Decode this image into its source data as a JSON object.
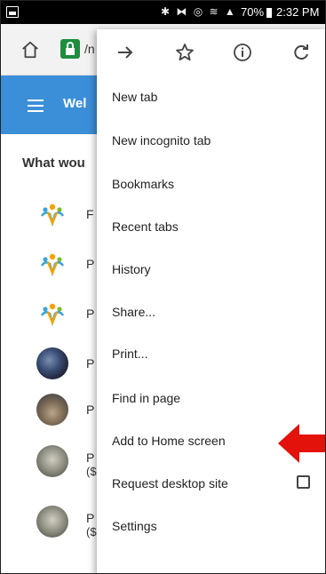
{
  "status_bar": {
    "icons": "✱ ⧓ ◎ ≋ ▲",
    "battery": "70%",
    "time": "2:32 PM"
  },
  "address_bar": {
    "url_fragment": "/n"
  },
  "app_header": {
    "title": "Wel"
  },
  "page": {
    "prompt": "What wou",
    "items": [
      {
        "label": "F",
        "sub": "",
        "avatar": "logo-lunch"
      },
      {
        "label": "P",
        "sub": "",
        "avatar": "logo-fees"
      },
      {
        "label": "P",
        "sub": "",
        "avatar": "logo-fundraiser"
      },
      {
        "label": "P",
        "sub": "",
        "avatar": "photo"
      },
      {
        "label": "P",
        "sub": "",
        "avatar": "photo"
      },
      {
        "label": "P",
        "sub": "($",
        "avatar": "photo"
      },
      {
        "label": "P",
        "sub": "($",
        "avatar": "photo"
      }
    ]
  },
  "menu": {
    "toolbar": [
      "forward-icon",
      "bookmark-star-icon",
      "info-icon",
      "reload-icon"
    ],
    "items": [
      "New tab",
      "New incognito tab",
      "Bookmarks",
      "Recent tabs",
      "History",
      "Share...",
      "Print...",
      "Find in page",
      "Add to Home screen",
      "Request desktop site",
      "Settings"
    ],
    "request_desktop_checked": false
  },
  "colors": {
    "header_blue": "#3b8fd9",
    "lock_green": "#1e8e3e",
    "arrow_red": "#e3120b"
  }
}
